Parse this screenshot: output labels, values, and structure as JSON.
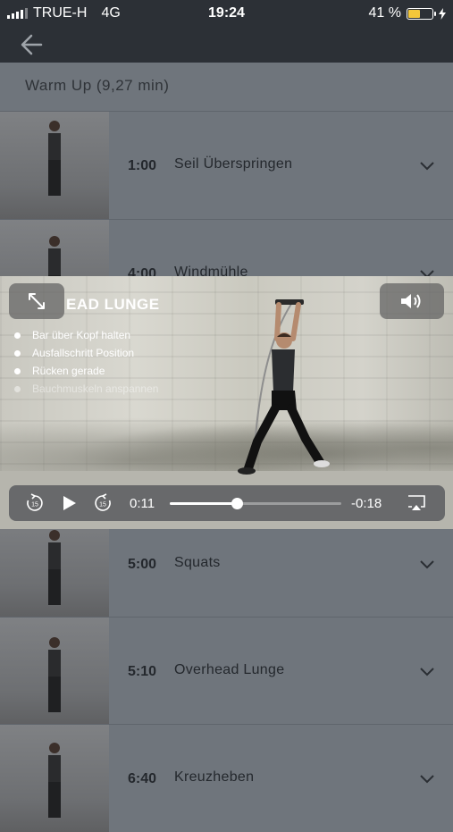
{
  "status": {
    "carrier": "TRUE-H",
    "network": "4G",
    "time": "19:24",
    "battery": "41 %",
    "battery_color": "#f3c73b"
  },
  "nav": {
    "back_icon": "arrow-left-icon"
  },
  "section": {
    "title": "Warm Up (9,27 min)"
  },
  "exercises": [
    {
      "time": "1:00",
      "name": "Seil Überspringen"
    },
    {
      "time": "4:00",
      "name": "Windmühle"
    },
    {
      "time": "5:00",
      "name": "Squats"
    },
    {
      "time": "5:10",
      "name": "Overhead Lunge"
    },
    {
      "time": "6:40",
      "name": "Kreuzheben"
    }
  ],
  "video": {
    "title": "EAD LUNGE",
    "cues": [
      "Bar über Kopf halten",
      "Ausfallschritt Position",
      "Rücken gerade",
      "Bauchmuskeln anspannen"
    ],
    "elapsed": "0:11",
    "remaining": "-0:18",
    "progress": 0.39
  }
}
